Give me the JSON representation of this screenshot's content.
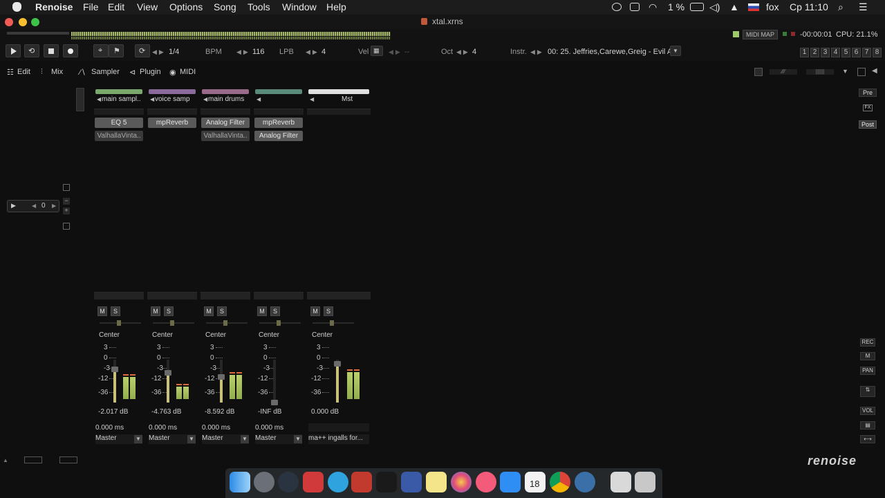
{
  "menubar": {
    "app_name": "Renoise",
    "items": [
      "File",
      "Edit",
      "View",
      "Options",
      "Song",
      "Tools",
      "Window",
      "Help"
    ],
    "battery": "1 %",
    "user": "fox",
    "clock": "Ср 11:10"
  },
  "window": {
    "title": "xtal.xrns"
  },
  "transport": {
    "pattern_fraction": "1/4",
    "bpm_label": "BPM",
    "bpm": "116",
    "lpb_label": "LPB",
    "lpb": "4",
    "vel_label": "Vel",
    "vel_value": "--",
    "oct_label": "Oct",
    "oct": "4",
    "instr_label": "Instr.",
    "instrument": "00: 25. Jeffries,Carewe,Greig - Evil A...",
    "midi_map": "MIDI MAP",
    "time": "-00:00:01",
    "cpu": "CPU: 21.1%",
    "track_numbers": [
      "1",
      "2",
      "3",
      "4",
      "5",
      "6",
      "7",
      "8"
    ]
  },
  "tabs": {
    "edit": "Edit",
    "mix": "Mix",
    "sampler": "Sampler",
    "plugin": "Plugin",
    "midi": "MIDI"
  },
  "left_panel": {
    "counter": "0"
  },
  "right_panel": {
    "pre": "Pre",
    "fx": "FX",
    "post": "Post",
    "rec": "REC",
    "pan": "PAN",
    "vol": "VOL"
  },
  "mixer": {
    "strips": [
      {
        "name": "main sampl..",
        "color": "#7aa86a",
        "devices": [
          {
            "label": "EQ 5",
            "state": "active"
          },
          {
            "label": "ValhallaVinta..",
            "state": "bypass"
          }
        ],
        "pan": "Center",
        "db": "-2.017 dB",
        "delay": "0.000 ms",
        "route": "Master",
        "fader_level": 0.78,
        "vu_left": 0.45,
        "vu_right": 0.45
      },
      {
        "name": "voice samp",
        "color": "#8a6a9a",
        "devices": [
          {
            "label": "mpReverb",
            "state": "active"
          }
        ],
        "pan": "Center",
        "db": "-4.763 dB",
        "delay": "0.000 ms",
        "route": "Master",
        "fader_level": 0.7,
        "vu_left": 0.25,
        "vu_right": 0.25
      },
      {
        "name": "main drums",
        "color": "#9a6a8a",
        "devices": [
          {
            "label": "Analog Filter",
            "state": "active"
          },
          {
            "label": "ValhallaVinta..",
            "state": "bypass"
          }
        ],
        "pan": "Center",
        "db": "-8.592 dB",
        "delay": "0.000 ms",
        "route": "Master",
        "fader_level": 0.6,
        "vu_left": 0.5,
        "vu_right": 0.5
      },
      {
        "name": "",
        "color": "#5a8a7a",
        "devices": [
          {
            "label": "mpReverb",
            "state": "active"
          },
          {
            "label": "Analog Filter",
            "state": "active"
          }
        ],
        "pan": "Center",
        "db": "-INF dB",
        "delay": "0.000 ms",
        "route": "Master",
        "fader_level": 0.0,
        "vu_left": 0.0,
        "vu_right": 0.0
      },
      {
        "name": "Mst",
        "color": "#e0e0e0",
        "devices": [],
        "pan": "Center",
        "db": "0.000 dB",
        "delay": "",
        "route": "ma++ ingalls for...",
        "fader_level": 0.9,
        "vu_left": 0.55,
        "vu_right": 0.55
      }
    ],
    "scale": [
      "3",
      "0",
      "-3",
      "-12",
      "-36"
    ]
  },
  "logo": "renoise",
  "dock": {
    "calendar_day": "18"
  }
}
